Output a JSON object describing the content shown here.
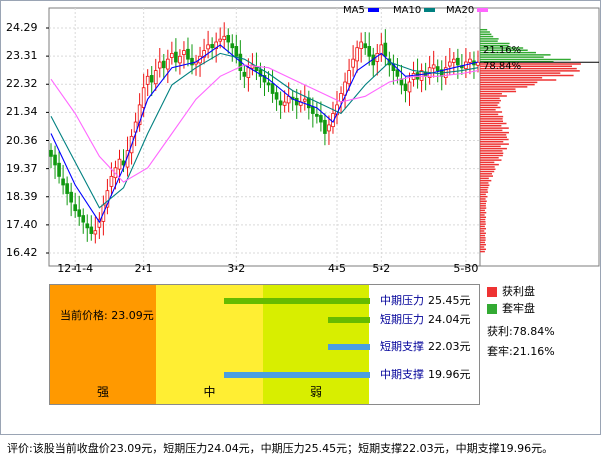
{
  "legend": [
    {
      "label": "MA5",
      "color": "#0000ff"
    },
    {
      "label": "MA10",
      "color": "#008080"
    },
    {
      "label": "MA20",
      "color": "#ff66ff"
    }
  ],
  "chart_data": {
    "type": "candlestick",
    "y_ticks": [
      "24.29",
      "23.31",
      "22.32",
      "21.34",
      "20.36",
      "19.37",
      "18.39",
      "17.40",
      "16.42"
    ],
    "ylim": [
      16.42,
      24.29
    ],
    "x_ticks": [
      "12-1-4",
      "2-1",
      "3-2",
      "4-5",
      "5-2",
      "5-30"
    ],
    "x_tick_index": [
      6,
      23,
      46,
      71,
      82,
      103
    ],
    "candle_count": 107,
    "closes": [
      19.8,
      19.5,
      19.1,
      18.8,
      18.5,
      18.2,
      17.9,
      17.7,
      17.5,
      17.3,
      17.1,
      17.2,
      17.6,
      18.1,
      18.6,
      19.1,
      19.4,
      19.7,
      19.5,
      20.0,
      20.5,
      21.0,
      21.6,
      22.2,
      22.6,
      22.4,
      22.8,
      23.1,
      22.9,
      23.2,
      23.4,
      23.1,
      23.3,
      23.5,
      23.2,
      23.0,
      23.1,
      23.3,
      23.5,
      23.7,
      23.6,
      23.8,
      23.9,
      24.0,
      23.8,
      23.6,
      23.3,
      22.8,
      22.6,
      22.9,
      23.0,
      22.8,
      22.6,
      22.4,
      22.3,
      22.0,
      21.8,
      21.6,
      21.7,
      21.9,
      21.8,
      21.6,
      21.7,
      21.8,
      21.5,
      21.3,
      21.2,
      21.0,
      20.6,
      20.9,
      21.3,
      21.6,
      22.0,
      22.4,
      22.8,
      23.2,
      23.6,
      23.8,
      23.6,
      23.3,
      23.0,
      23.4,
      23.7,
      23.3,
      23.0,
      22.8,
      22.6,
      22.3,
      22.1,
      22.4,
      22.7,
      22.5,
      22.8,
      22.6,
      22.9,
      23.0,
      22.8,
      22.6,
      22.9,
      23.1,
      23.2,
      23.0,
      22.9,
      23.1,
      23.2,
      23.0,
      23.09
    ],
    "ma_series": [
      {
        "name": "MA5",
        "color": "#0000ff",
        "points": [
          [
            0,
            20.6
          ],
          [
            6,
            18.8
          ],
          [
            12,
            17.5
          ],
          [
            18,
            19.4
          ],
          [
            24,
            21.8
          ],
          [
            30,
            22.9
          ],
          [
            36,
            23.1
          ],
          [
            42,
            23.7
          ],
          [
            48,
            23.0
          ],
          [
            54,
            22.5
          ],
          [
            60,
            21.8
          ],
          [
            66,
            21.5
          ],
          [
            70,
            21.0
          ],
          [
            76,
            22.8
          ],
          [
            82,
            23.4
          ],
          [
            88,
            22.6
          ],
          [
            94,
            22.7
          ],
          [
            100,
            22.9
          ],
          [
            106,
            23.1
          ]
        ]
      },
      {
        "name": "MA10",
        "color": "#008080",
        "points": [
          [
            0,
            21.2
          ],
          [
            6,
            19.6
          ],
          [
            12,
            18.0
          ],
          [
            18,
            18.7
          ],
          [
            24,
            20.6
          ],
          [
            30,
            22.3
          ],
          [
            36,
            22.9
          ],
          [
            42,
            23.4
          ],
          [
            48,
            23.2
          ],
          [
            54,
            22.7
          ],
          [
            60,
            22.1
          ],
          [
            66,
            21.7
          ],
          [
            72,
            21.3
          ],
          [
            78,
            22.3
          ],
          [
            84,
            23.1
          ],
          [
            90,
            22.8
          ],
          [
            96,
            22.7
          ],
          [
            102,
            22.8
          ],
          [
            106,
            22.9
          ]
        ]
      },
      {
        "name": "MA20",
        "color": "#ff66ff",
        "points": [
          [
            0,
            22.5
          ],
          [
            6,
            21.3
          ],
          [
            12,
            19.8
          ],
          [
            18,
            18.9
          ],
          [
            24,
            19.4
          ],
          [
            30,
            20.6
          ],
          [
            36,
            21.8
          ],
          [
            42,
            22.6
          ],
          [
            48,
            23.0
          ],
          [
            54,
            22.9
          ],
          [
            60,
            22.5
          ],
          [
            66,
            22.1
          ],
          [
            72,
            21.7
          ],
          [
            78,
            21.9
          ],
          [
            84,
            22.4
          ],
          [
            90,
            22.6
          ],
          [
            96,
            22.6
          ],
          [
            102,
            22.7
          ],
          [
            106,
            22.8
          ]
        ]
      }
    ],
    "profile_current_price": 23.09,
    "profile_profit_pct": "78.84%",
    "profile_trapped_pct": "21.16%"
  },
  "panel": {
    "price_label": "当前价格:",
    "price_value": "23.09元",
    "columns": [
      {
        "label": "强",
        "color": "#ff9900"
      },
      {
        "label": "中",
        "color": "#ffee33"
      },
      {
        "label": "弱",
        "color": "#d8ee00"
      }
    ],
    "levels": [
      {
        "name": "中期压力",
        "value": "25.45元",
        "color": "#66bb00",
        "fraction": 0.55
      },
      {
        "name": "短期压力",
        "value": "24.04元",
        "color": "#66bb00",
        "fraction": 0.16
      },
      {
        "name": "短期支撑",
        "value": "22.03元",
        "color": "#4a9ee0",
        "fraction": 0.16
      },
      {
        "name": "中期支撑",
        "value": "19.96元",
        "color": "#4a9ee0",
        "fraction": 0.55
      }
    ]
  },
  "profile_legend": [
    {
      "label": "获利盘",
      "color": "#ee3333"
    },
    {
      "label": "套牢盘",
      "color": "#33aa33"
    }
  ],
  "stats": {
    "profit_label": "获利:",
    "profit_value": "78.84%",
    "trapped_label": "套牢:",
    "trapped_value": "21.16%"
  },
  "comment": "评价:该股当前收盘价23.09元，短期压力24.04元，中期压力25.45元；短期支撑22.03元，中期支撑19.96元。"
}
